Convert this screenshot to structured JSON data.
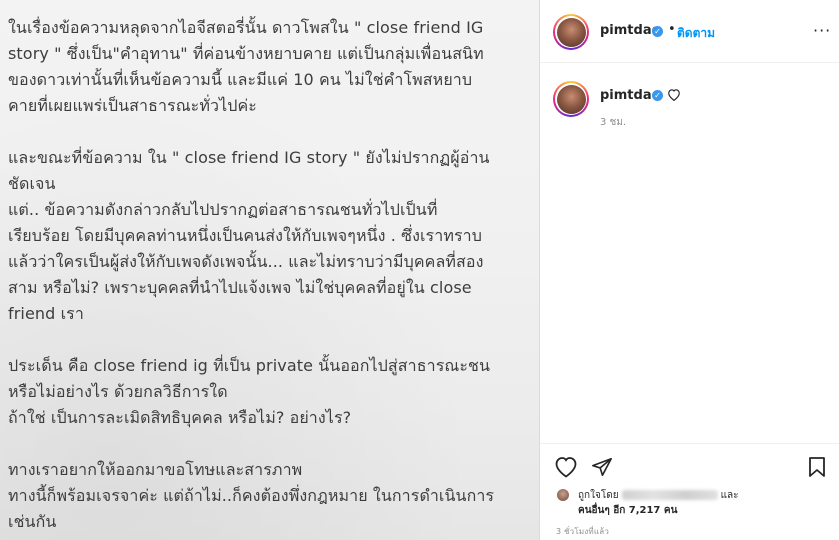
{
  "post": {
    "lines": [
      "ในเรื่องข้อความหลุดจากไอจีสตอรี่นั้น ดาวโพสใน \" close friend IG",
      "story \" ซึ่งเป็น\"คำอุทาน\" ที่ค่อนข้างหยาบคาย แต่เป็นกลุ่มเพื่อนสนิท",
      "ของดาวเท่านั้นที่เห็นข้อความนี้ และมีแค่ 10 คน ไม่ใช่คำโพสหยาบ",
      "คายที่เผยแพร่เป็นสาธารณะทั่วไปค่ะ",
      "",
      "และขณะที่ข้อความ ใน \" close friend IG story \" ยังไม่ปรากฏผู้อ่าน",
      "ชัดเจน",
      "แต่.. ข้อความดังกล่าวกลับไปปรากฏต่อสาธารณชนทั่วไปเป็นที่",
      "เรียบร้อย โดยมีบุคคลท่านหนึ่งเป็นคนส่งให้กับเพจๆหนึ่ง . ซึ่งเราทราบ",
      "แล้วว่าใครเป็นผู้ส่งให้กับเพจดังเพจนั้น... และไม่ทราบว่ามีบุคคลที่สอง",
      "สาม หรือไม่? เพราะบุคคลที่นำไปแจ้งเพจ ไม่ใช่บุคคลที่อยู่ใน close",
      "friend เรา",
      "",
      "ประเด็น คือ close friend ig ที่เป็น private นั้นออกไปสู่สาธารณะชน",
      "หรือไม่อย่างไร ด้วยกลวิธีการใด",
      "ถ้าใช่ เป็นการละเมิดสิทธิบุคคล หรือไม่? อย่างไร?",
      "",
      "ทางเราอยากให้ออกมาขอโทษและสารภาพ",
      "ทางนี้ก็พร้อมเจรจาค่ะ แต่ถ้าไม่..ก็คงต้องพึ่งกฎหมาย ในการดำเนินการ",
      "เช่นกัน"
    ]
  },
  "header": {
    "username": "pimtdao",
    "separator": "•",
    "follow_label": "ติดตาม",
    "more": "···"
  },
  "comment": {
    "username": "pimtdao",
    "time": "3 ชม."
  },
  "likes": {
    "prefix": "ถูกใจโดย",
    "and": "และ",
    "others": "คนอื่นๆ อีก 7,217 คน"
  },
  "posted_ago": "3 ชั่วโมงที่แล้ว",
  "colors": {
    "verified": "#3897f0",
    "follow": "#0095f6",
    "text": "#262626",
    "muted": "#8e8e8e"
  },
  "icons": [
    "verified-icon",
    "more-icon",
    "heart-icon",
    "comment-icon",
    "share-icon",
    "bookmark-icon"
  ]
}
